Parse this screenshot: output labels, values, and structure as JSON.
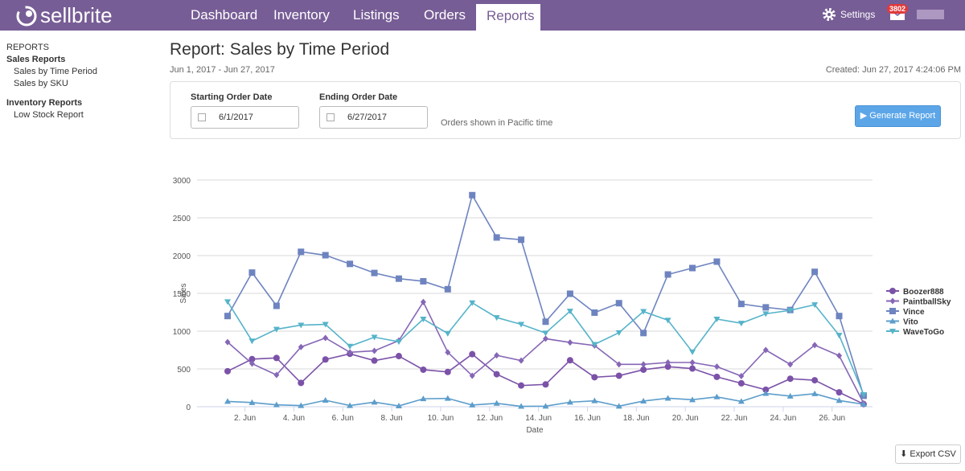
{
  "app": {
    "name": "sellbrite",
    "brand_color": "#775d96"
  },
  "nav": {
    "items": [
      {
        "label": "Dashboard"
      },
      {
        "label": "Inventory"
      },
      {
        "label": "Listings"
      },
      {
        "label": "Orders"
      },
      {
        "label": "Reports",
        "active": true
      }
    ],
    "settings": "Settings",
    "mail_count": "3802"
  },
  "sidebar": {
    "section": "REPORTS",
    "groups": [
      {
        "title": "Sales Reports",
        "items": [
          "Sales by Time Period",
          "Sales by SKU"
        ]
      },
      {
        "title": "Inventory Reports",
        "items": [
          "Low Stock Report"
        ]
      }
    ]
  },
  "report": {
    "title": "Report: Sales by Time Period",
    "range": "Jun 1, 2017 - Jun 27, 2017",
    "created": "Created: Jun 27, 2017 4:24:06 PM",
    "start_label": "Starting Order Date",
    "start_value": "6/1/2017",
    "end_label": "Ending Order Date",
    "end_value": "6/27/2017",
    "note": "Orders shown in Pacific time",
    "generate": "Generate Report",
    "export": "Export CSV"
  },
  "chart_data": {
    "type": "line",
    "xlabel": "Date",
    "ylabel": "Sales",
    "ylim": [
      0,
      3000
    ],
    "yticks": [
      0,
      500,
      1000,
      1500,
      2000,
      2500,
      3000
    ],
    "x": [
      "Jun 1",
      "Jun 2",
      "Jun 3",
      "Jun 4",
      "Jun 5",
      "Jun 6",
      "Jun 7",
      "Jun 8",
      "Jun 9",
      "Jun 10",
      "Jun 11",
      "Jun 12",
      "Jun 13",
      "Jun 14",
      "Jun 15",
      "Jun 16",
      "Jun 17",
      "Jun 18",
      "Jun 19",
      "Jun 20",
      "Jun 21",
      "Jun 22",
      "Jun 23",
      "Jun 24",
      "Jun 25",
      "Jun 26",
      "Jun 27"
    ],
    "xticks": [
      "2. Jun",
      "4. Jun",
      "6. Jun",
      "8. Jun",
      "10. Jun",
      "12. Jun",
      "14. Jun",
      "16. Jun",
      "18. Jun",
      "20. Jun",
      "22. Jun",
      "24. Jun",
      "26. Jun"
    ],
    "grid": true,
    "legend": "right",
    "series": [
      {
        "name": "Boozer888",
        "color": "#7b52a8",
        "marker": "circle",
        "values": [
          470,
          630,
          645,
          315,
          625,
          700,
          610,
          670,
          490,
          460,
          695,
          430,
          280,
          295,
          615,
          390,
          410,
          490,
          530,
          505,
          395,
          310,
          225,
          370,
          350,
          190,
          35
        ]
      },
      {
        "name": "PaintballSky",
        "color": "#8666b6",
        "marker": "diamond",
        "values": [
          855,
          570,
          420,
          790,
          910,
          720,
          740,
          875,
          1385,
          720,
          410,
          680,
          610,
          900,
          850,
          810,
          560,
          560,
          585,
          585,
          530,
          405,
          750,
          560,
          815,
          675,
          45
        ]
      },
      {
        "name": "Vince",
        "color": "#6e84c0",
        "marker": "square",
        "values": [
          1200,
          1775,
          1335,
          2050,
          2005,
          1890,
          1770,
          1695,
          1660,
          1555,
          2800,
          2240,
          2210,
          1125,
          1495,
          1245,
          1370,
          975,
          1750,
          1835,
          1920,
          1360,
          1315,
          1280,
          1785,
          1200,
          145
        ]
      },
      {
        "name": "Vito",
        "color": "#5c9dcb",
        "marker": "triangle",
        "values": [
          70,
          55,
          25,
          15,
          85,
          15,
          60,
          10,
          105,
          110,
          22,
          45,
          5,
          7,
          60,
          78,
          7,
          75,
          112,
          92,
          130,
          70,
          175,
          140,
          172,
          82,
          32
        ]
      },
      {
        "name": "WaveToGo",
        "color": "#55b3c9",
        "marker": "triangle-down",
        "values": [
          1390,
          870,
          1025,
          1080,
          1090,
          800,
          920,
          860,
          1160,
          970,
          1375,
          1180,
          1090,
          975,
          1265,
          825,
          980,
          1260,
          1145,
          725,
          1160,
          1105,
          1230,
          1275,
          1350,
          945,
          160
        ]
      }
    ]
  }
}
